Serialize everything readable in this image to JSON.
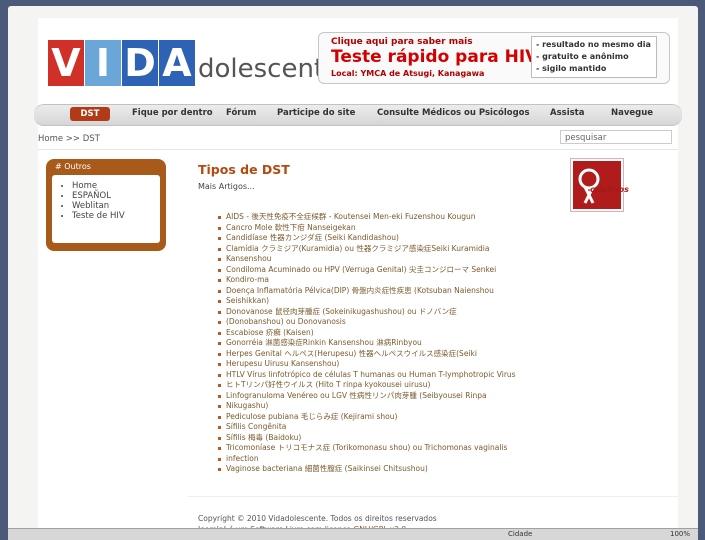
{
  "logo": {
    "letters": [
      {
        "char": "V",
        "color": "#d03027"
      },
      {
        "char": "I",
        "color": "#6aa6d8"
      },
      {
        "char": "D",
        "color": "#2e62b5"
      },
      {
        "char": "A",
        "color": "#2e62b5"
      }
    ],
    "rest": "dolescente"
  },
  "hiv_banner": {
    "top_text": "Clique aqui para saber mais",
    "title": "Teste rápido para HIV",
    "local": "Local: YMCA de Atsugi, Kanagawa",
    "features": [
      "- resultado no mesmo dia",
      "- gratuito e anônimo",
      "- sigilo mantido"
    ]
  },
  "nav": {
    "active": "DST",
    "items": [
      "Fique por dentro",
      "Fórum",
      "Participe do site",
      "Consulte Médicos ou Psicólogos",
      "Assista",
      "Navegue"
    ]
  },
  "breadcrumb": "Home >> DST",
  "search": {
    "placeholder": "pesquisar"
  },
  "sidebar": {
    "title": "# Outros",
    "items": [
      "Home",
      "ESPAÑOL",
      "Weblitan",
      "Teste de HIV"
    ]
  },
  "main": {
    "title": "Tipos de DST",
    "subtitle": "Mais Artigos...",
    "articles": [
      "AIDS - 後天性免疫不全症候群 - Koutensei Men-eki Fuzenshou Kougun",
      "Cancro Mole 軟性下疳 Nanseigekan",
      "Candidíase 性器カンジダ症 (Seiki Kandidashou)",
      "Clamídia クラミジア(Kuramidia) ou 性器クラミジア感染症Seiki Kuramidia",
      "Kansenshou",
      "Condiloma Acuminado ou HPV (Verruga Genital) 尖圭コンジローマ Senkei",
      "Kondiro-ma",
      "Doença Inflamatória Pélvica(DIP) 骨盤内炎症性疾患 (Kotsuban Naienshou",
      "Seishikkan)",
      "Donovanose 鼠径肉芽腫症 (Sokeinikugashushou) ou ドノバン症",
      "(Donobanshou) ou Donovanosis",
      "Escabiose 疥癬 (Kaisen)",
      "Gonorréia 淋菌感染症Rinkin Kansenshou 淋病Rinbyou",
      "Herpes Genital ヘルペス(Herupesu) 性器ヘルペスウイルス感染症(Seiki",
      "Herupesu Uirusu Kansenshou)",
      "HTLV Vírus linfotrópico de células T humanas ou Human T-lymphotropic Virus",
      "ヒトTリンパ好性ウイルス (Hito T rinpa kyokousei uirusu)",
      "Linfogranuloma Venéreo ou LGV 性病性リンパ肉芽腫 (Seibyousei Rinpa",
      "Nikugashu)",
      "Pediculose pubiana 毛じらみ症 (Kejirami shou)",
      "Sífilis Congênita",
      "Sífilis 梅毒 (Baidoku)",
      "Tricomoníase トリコモナス症 (Torikomonasu shou) ou Trichomonas vaginalis",
      "infection",
      "Vaginose bacteriana 細菌性膣症 (Saikinsei Chitsushou)"
    ]
  },
  "badge": {
    "label": "criativos"
  },
  "footer": {
    "copyright": "Copyright © 2010 Vidadolescente. Todos os direitos reservados",
    "joomla_prefix": "Joomla! é um Software Livre com",
    "joomla_link": "licença GNU/GPL v2.0"
  },
  "status": {
    "zone": "Cidade",
    "zoom": "100%"
  }
}
